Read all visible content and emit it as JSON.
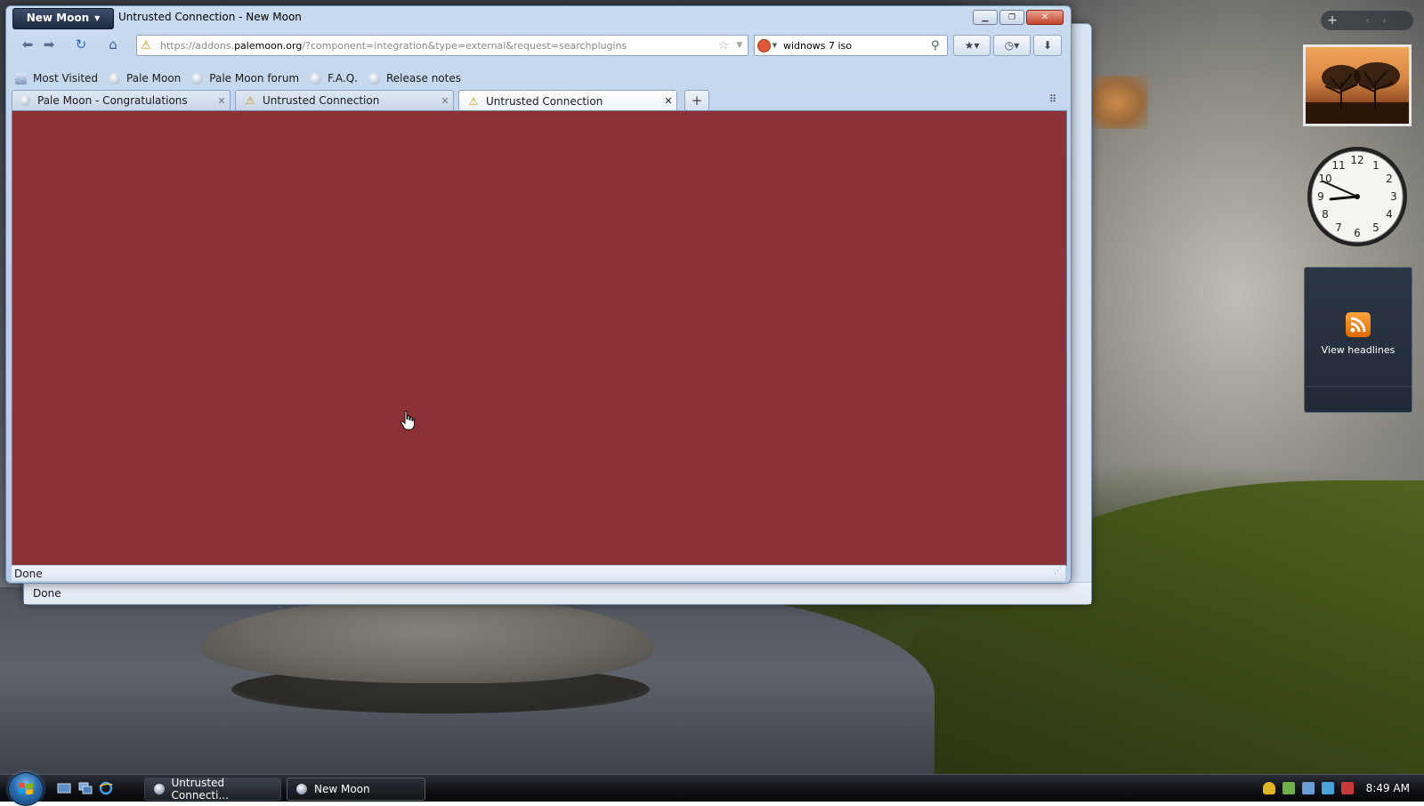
{
  "window": {
    "app_menu_label": "New Moon",
    "title": "Untrusted Connection - New Moon"
  },
  "navbar": {
    "url_prefix": "https://addons.",
    "url_domain": "palemoon.org",
    "url_path": "/?component=integration&type=external&request=searchplugins",
    "search_query": "widnows 7 iso"
  },
  "bookmarks": [
    {
      "label": "Most Visited"
    },
    {
      "label": "Pale Moon"
    },
    {
      "label": "Pale Moon forum"
    },
    {
      "label": "F.A.Q."
    },
    {
      "label": "Release notes"
    }
  ],
  "tabs": [
    {
      "label": "Pale Moon - Congratulations",
      "icon": "globe-icon",
      "active": false
    },
    {
      "label": "Untrusted Connection",
      "icon": "warning-icon",
      "active": false
    },
    {
      "label": "Untrusted Connection",
      "icon": "warning-icon",
      "active": true
    }
  ],
  "status": {
    "main": "Done",
    "back_window": "Done"
  },
  "content": {
    "background_color": "#8a3235"
  },
  "gadgets": {
    "feed_label": "View headlines",
    "clock_time": {
      "hour": 8,
      "minute": 49
    }
  },
  "taskbar": {
    "buttons": [
      {
        "label": "Untrusted Connecti..."
      },
      {
        "label": "New Moon"
      }
    ],
    "clock": "8:49 AM"
  }
}
